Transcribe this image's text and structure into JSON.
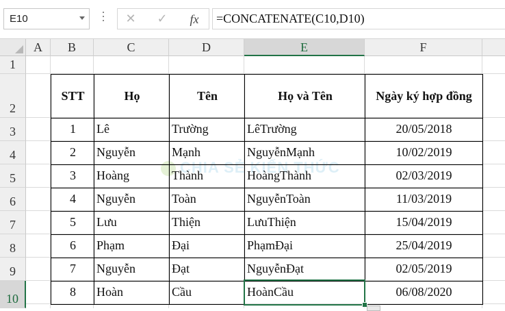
{
  "name_box": {
    "value": "E10"
  },
  "formula_bar": {
    "cancel_icon": "✕",
    "enter_icon": "✓",
    "function_icon": "fx",
    "formula": "=CONCATENATE(C10,D10)"
  },
  "columns": [
    "A",
    "B",
    "C",
    "D",
    "E",
    "F"
  ],
  "active_column": "E",
  "rows": [
    "1",
    "2",
    "3",
    "4",
    "5",
    "6",
    "7",
    "8",
    "9",
    "10"
  ],
  "active_row": "10",
  "table": {
    "headers": [
      "STT",
      "Họ",
      "Tên",
      "Họ và Tên",
      "Ngày ký hợp đồng"
    ],
    "records": [
      [
        "1",
        "Lê",
        "Trường",
        "LêTrường",
        "20/05/2018"
      ],
      [
        "2",
        "Nguyễn",
        "Mạnh",
        "NguyễnMạnh",
        "10/02/2019"
      ],
      [
        "3",
        "Hoàng",
        "Thành",
        "HoàngThành",
        "02/03/2019"
      ],
      [
        "4",
        "Nguyễn",
        "Toàn",
        "NguyễnToàn",
        "11/03/2019"
      ],
      [
        "5",
        "Lưu",
        "Thiện",
        "LưuThiện",
        "15/04/2019"
      ],
      [
        "6",
        "Phạm",
        "Đại",
        "PhạmĐại",
        "25/04/2019"
      ],
      [
        "7",
        "Nguyễn",
        "Đạt",
        "NguyễnĐạt",
        "02/05/2019"
      ],
      [
        "8",
        "Hoàn",
        "Cầu",
        "HoànCầu",
        "06/08/2020"
      ]
    ]
  },
  "watermark": {
    "text": "CHIA SẺ KIẾN THỨC"
  },
  "colors": {
    "selection": "#217346",
    "header_bg": "#efefef",
    "active_header_bg": "#d7d7d7"
  }
}
